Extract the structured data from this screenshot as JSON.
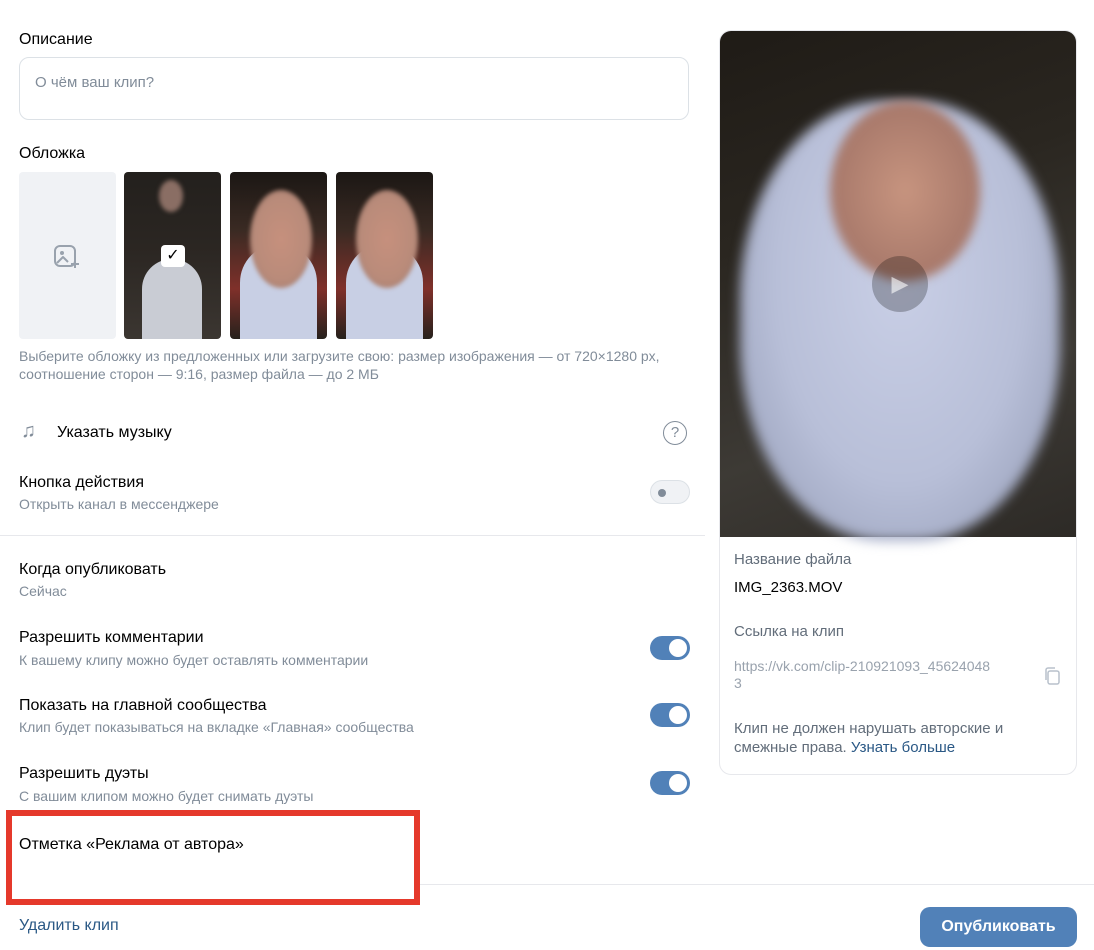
{
  "description": {
    "label": "Описание",
    "placeholder": "О чём ваш клип?"
  },
  "cover": {
    "label": "Обложка",
    "upload_icon": "image-add-icon",
    "selected_check": "✓",
    "hint": "Выберите обложку из предложенных или загрузите свою: размер изображения — от 720×1280 px, соотношение сторон — 9:16, размер файла — до 2 МБ"
  },
  "music": {
    "icon": "music-note-icon",
    "label": "Указать музыку",
    "help_icon": "?"
  },
  "action_button": {
    "label": "Кнопка действия",
    "sub": "Открыть канал в мессенджере",
    "enabled": false
  },
  "publish_time": {
    "label": "Когда опубликовать",
    "value": "Сейчас"
  },
  "options": [
    {
      "label": "Разрешить комментарии",
      "sub": "К вашему клипу можно будет оставлять комментарии",
      "enabled": true
    },
    {
      "label": "Показать на главной сообщества",
      "sub": "Клип будет показываться на вкладке «Главная» сообщества",
      "enabled": true
    },
    {
      "label": "Разрешить дуэты",
      "sub": "С вашим клипом можно будет снимать дуэты",
      "enabled": true
    }
  ],
  "ad_mark": {
    "label": "Отметка «Реклама от автора»"
  },
  "footer": {
    "delete_label": "Удалить клип",
    "publish_label": "Опубликовать"
  },
  "preview": {
    "file_name_label": "Название файла",
    "file_name": "IMG_2363.MOV",
    "link_label": "Ссылка на клип",
    "link": "https://vk.com/clip-210921093_456240483",
    "note": "Клип не должен нарушать авторские и смежные права.",
    "learn_more": "Узнать больше"
  },
  "colors": {
    "accent": "#5181b8",
    "link": "#2a5885",
    "annotation_red": "#e5392b"
  }
}
